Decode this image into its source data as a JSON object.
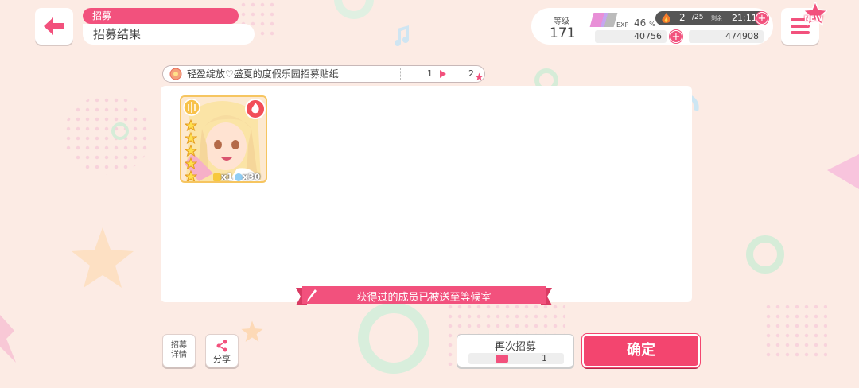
{
  "header": {
    "category": "招募",
    "title": "招募结果"
  },
  "status": {
    "level_label": "等级",
    "level": "171",
    "exp_label": "EXP",
    "exp_percent": "46",
    "exp_unit": "%",
    "stamina_current": "2",
    "stamina_max": "/25",
    "remaining_label": "剩余",
    "remaining_time": "21:11",
    "stars": "40756",
    "coins": "474908"
  },
  "menu": {
    "new_badge": "NEW"
  },
  "gacha": {
    "name": "轻盈绽放♡盛夏的度假乐园招募贴纸",
    "page_current": "1",
    "page_next": "2"
  },
  "card": {
    "rarity_stars": 5,
    "attribute": "fire-icon",
    "quantity": "x1",
    "stars_gain": "x30"
  },
  "notice": "获得过的成员已被送至等候室",
  "buttons": {
    "details": "招募\n详情",
    "details_line1": "招募",
    "details_line2": "详情",
    "share": "分享",
    "again": "再次招募",
    "again_count": "1",
    "confirm": "确定"
  },
  "colors": {
    "accent": "#f2517d",
    "background": "#fcebe4"
  }
}
